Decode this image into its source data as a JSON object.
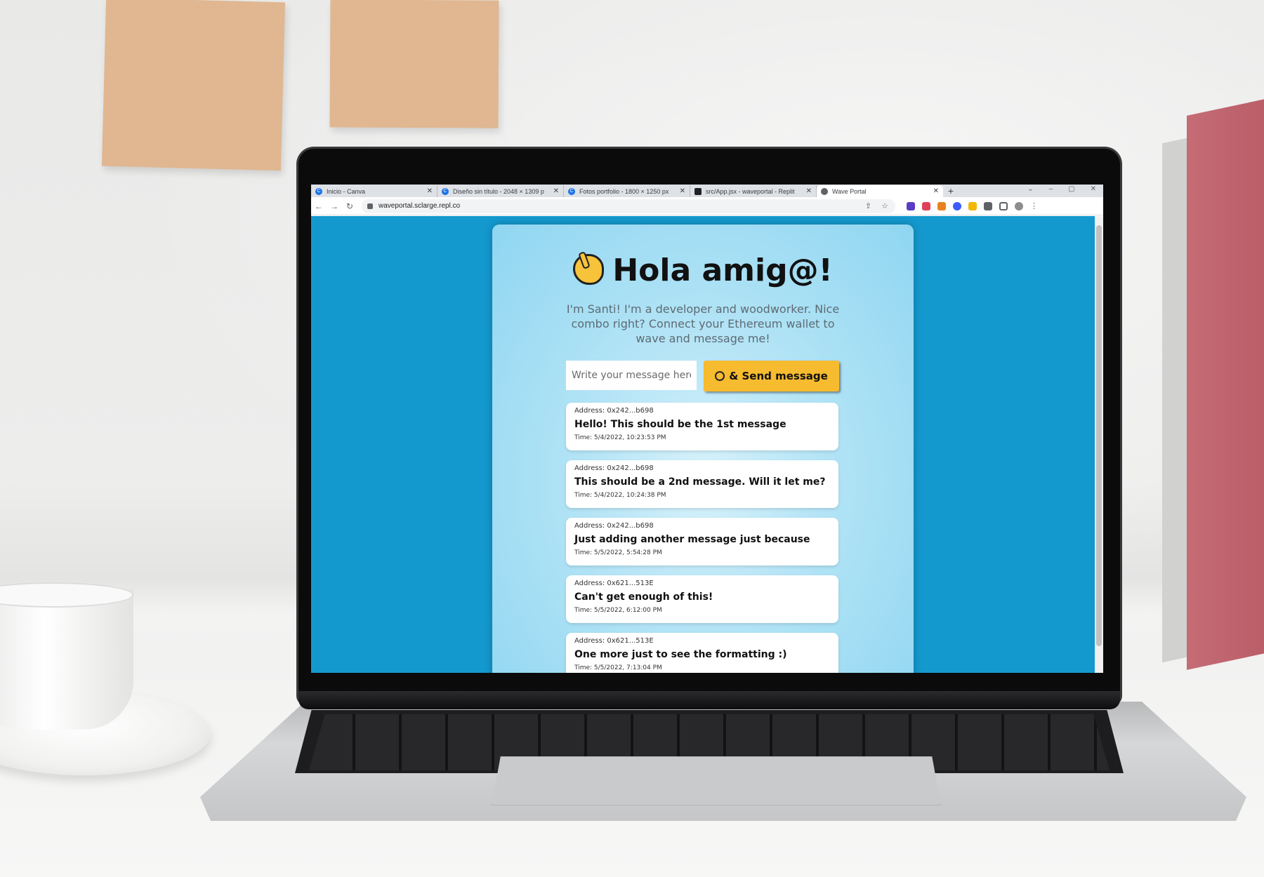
{
  "browser": {
    "tabs": [
      {
        "label": "Inicio - Canva",
        "icon": "canva-icon",
        "active": false
      },
      {
        "label": "Diseño sin título - 2048 × 1309 p",
        "icon": "canva-icon",
        "active": false
      },
      {
        "label": "Fotos portfolio - 1800 × 1250 px",
        "icon": "canva-icon",
        "active": false
      },
      {
        "label": "src/App.jsx - waveportal - Replit",
        "icon": "replit-icon",
        "active": false
      },
      {
        "label": "Wave Portal",
        "icon": "globe-icon",
        "active": true
      }
    ],
    "url": "waveportal.sclarge.repl.co"
  },
  "page": {
    "title": "Hola amig@!",
    "intro": "I'm Santi! I'm a developer and woodworker. Nice combo right? Connect your Ethereum wallet to wave and message me!",
    "input_placeholder": "Write your message here",
    "send_label": "& Send message",
    "messages": [
      {
        "address": "Address: 0x242...b698",
        "text": "Hello! This should be the 1st message",
        "time": "Time: 5/4/2022, 10:23:53 PM"
      },
      {
        "address": "Address: 0x242...b698",
        "text": "This should be a 2nd message. Will it let me?",
        "time": "Time: 5/4/2022, 10:24:38 PM"
      },
      {
        "address": "Address: 0x242...b698",
        "text": "Just adding another message just because",
        "time": "Time: 5/5/2022, 5:54:28 PM"
      },
      {
        "address": "Address: 0x621...513E",
        "text": "Can't get enough of this!",
        "time": "Time: 5/5/2022, 6:12:00 PM"
      },
      {
        "address": "Address: 0x621...513E",
        "text": "One more just to see the formatting :)",
        "time": "Time: 5/5/2022, 7:13:04 PM"
      }
    ]
  },
  "colors": {
    "page_background": "#1499cf",
    "button": "#f6bb2f"
  }
}
